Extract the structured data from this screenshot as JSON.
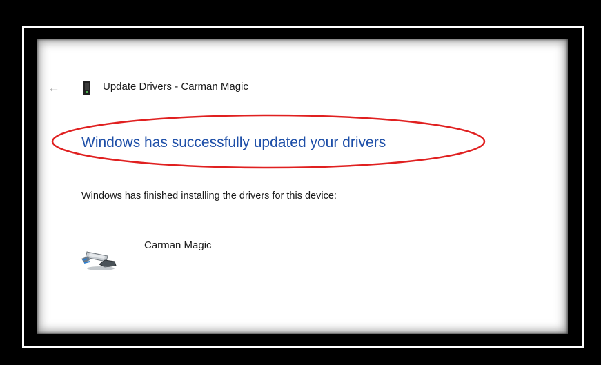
{
  "window": {
    "title": "Update Drivers - Carman Magic",
    "back_icon": "arrow-left-icon",
    "device_icon": "device-icon"
  },
  "content": {
    "heading": "Windows has successfully updated your drivers",
    "body_text": "Windows has finished installing the drivers for this device:",
    "device_name": "Carman Magic",
    "device_image_icon": "usb-device-icon"
  },
  "annotation": {
    "shape": "ellipse",
    "color": "#e02020"
  },
  "colors": {
    "heading": "#1e4fa8",
    "background": "#ffffff",
    "frame": "#000000"
  }
}
